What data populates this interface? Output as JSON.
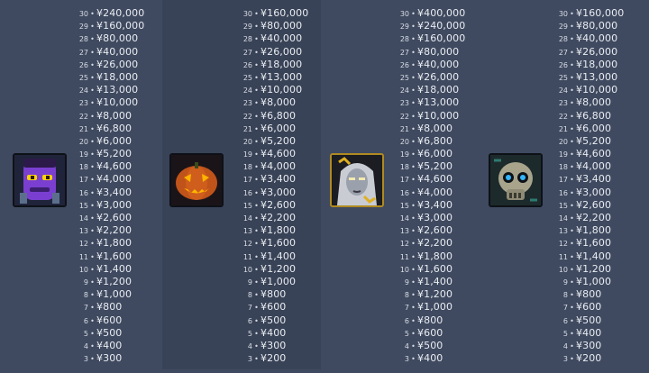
{
  "columns": [
    {
      "character": "purple-zombie",
      "rows": [
        {
          "level": "30",
          "amount": "¥240,000"
        },
        {
          "level": "29",
          "amount": "¥160,000"
        },
        {
          "level": "28",
          "amount": "¥80,000"
        },
        {
          "level": "27",
          "amount": "¥40,000"
        },
        {
          "level": "26",
          "amount": "¥26,000"
        },
        {
          "level": "25",
          "amount": "¥18,000"
        },
        {
          "level": "24",
          "amount": "¥13,000"
        },
        {
          "level": "23",
          "amount": "¥10,000"
        },
        {
          "level": "22",
          "amount": "¥8,000"
        },
        {
          "level": "21",
          "amount": "¥6,800"
        },
        {
          "level": "20",
          "amount": "¥6,000"
        },
        {
          "level": "19",
          "amount": "¥5,200"
        },
        {
          "level": "18",
          "amount": "¥4,600"
        },
        {
          "level": "17",
          "amount": "¥4,000"
        },
        {
          "level": "16",
          "amount": "¥3,400"
        },
        {
          "level": "15",
          "amount": "¥3,000"
        },
        {
          "level": "14",
          "amount": "¥2,600"
        },
        {
          "level": "13",
          "amount": "¥2,200"
        },
        {
          "level": "12",
          "amount": "¥1,800"
        },
        {
          "level": "11",
          "amount": "¥1,600"
        },
        {
          "level": "10",
          "amount": "¥1,400"
        },
        {
          "level": "9",
          "amount": "¥1,200"
        },
        {
          "level": "8",
          "amount": "¥1,000"
        },
        {
          "level": "7",
          "amount": "¥800"
        },
        {
          "level": "6",
          "amount": "¥600"
        },
        {
          "level": "5",
          "amount": "¥500"
        },
        {
          "level": "4",
          "amount": "¥400"
        },
        {
          "level": "3",
          "amount": "¥300"
        }
      ]
    },
    {
      "character": "jack-o-lantern",
      "rows": [
        {
          "level": "30",
          "amount": "¥160,000"
        },
        {
          "level": "29",
          "amount": "¥80,000"
        },
        {
          "level": "28",
          "amount": "¥40,000"
        },
        {
          "level": "27",
          "amount": "¥26,000"
        },
        {
          "level": "26",
          "amount": "¥18,000"
        },
        {
          "level": "25",
          "amount": "¥13,000"
        },
        {
          "level": "24",
          "amount": "¥10,000"
        },
        {
          "level": "23",
          "amount": "¥8,000"
        },
        {
          "level": "22",
          "amount": "¥6,800"
        },
        {
          "level": "21",
          "amount": "¥6,000"
        },
        {
          "level": "20",
          "amount": "¥5,200"
        },
        {
          "level": "19",
          "amount": "¥4,600"
        },
        {
          "level": "18",
          "amount": "¥4,000"
        },
        {
          "level": "17",
          "amount": "¥3,400"
        },
        {
          "level": "16",
          "amount": "¥3,000"
        },
        {
          "level": "15",
          "amount": "¥2,600"
        },
        {
          "level": "14",
          "amount": "¥2,200"
        },
        {
          "level": "13",
          "amount": "¥1,800"
        },
        {
          "level": "12",
          "amount": "¥1,600"
        },
        {
          "level": "11",
          "amount": "¥1,400"
        },
        {
          "level": "10",
          "amount": "¥1,200"
        },
        {
          "level": "9",
          "amount": "¥1,000"
        },
        {
          "level": "8",
          "amount": "¥800"
        },
        {
          "level": "7",
          "amount": "¥600"
        },
        {
          "level": "6",
          "amount": "¥500"
        },
        {
          "level": "5",
          "amount": "¥400"
        },
        {
          "level": "4",
          "amount": "¥300"
        },
        {
          "level": "3",
          "amount": "¥200"
        }
      ]
    },
    {
      "character": "ghost-bride",
      "rows": [
        {
          "level": "30",
          "amount": "¥400,000"
        },
        {
          "level": "29",
          "amount": "¥240,000"
        },
        {
          "level": "28",
          "amount": "¥160,000"
        },
        {
          "level": "27",
          "amount": "¥80,000"
        },
        {
          "level": "26",
          "amount": "¥40,000"
        },
        {
          "level": "25",
          "amount": "¥26,000"
        },
        {
          "level": "24",
          "amount": "¥18,000"
        },
        {
          "level": "23",
          "amount": "¥13,000"
        },
        {
          "level": "22",
          "amount": "¥10,000"
        },
        {
          "level": "21",
          "amount": "¥8,000"
        },
        {
          "level": "20",
          "amount": "¥6,800"
        },
        {
          "level": "19",
          "amount": "¥6,000"
        },
        {
          "level": "18",
          "amount": "¥5,200"
        },
        {
          "level": "17",
          "amount": "¥4,600"
        },
        {
          "level": "16",
          "amount": "¥4,000"
        },
        {
          "level": "15",
          "amount": "¥3,400"
        },
        {
          "level": "14",
          "amount": "¥3,000"
        },
        {
          "level": "13",
          "amount": "¥2,600"
        },
        {
          "level": "12",
          "amount": "¥2,200"
        },
        {
          "level": "11",
          "amount": "¥1,800"
        },
        {
          "level": "10",
          "amount": "¥1,600"
        },
        {
          "level": "9",
          "amount": "¥1,400"
        },
        {
          "level": "8",
          "amount": "¥1,200"
        },
        {
          "level": "7",
          "amount": "¥1,000"
        },
        {
          "level": "6",
          "amount": "¥800"
        },
        {
          "level": "5",
          "amount": "¥600"
        },
        {
          "level": "4",
          "amount": "¥500"
        },
        {
          "level": "3",
          "amount": "¥400"
        }
      ]
    },
    {
      "character": "skull-monster",
      "rows": [
        {
          "level": "30",
          "amount": "¥160,000"
        },
        {
          "level": "29",
          "amount": "¥80,000"
        },
        {
          "level": "28",
          "amount": "¥40,000"
        },
        {
          "level": "27",
          "amount": "¥26,000"
        },
        {
          "level": "26",
          "amount": "¥18,000"
        },
        {
          "level": "25",
          "amount": "¥13,000"
        },
        {
          "level": "24",
          "amount": "¥10,000"
        },
        {
          "level": "23",
          "amount": "¥8,000"
        },
        {
          "level": "22",
          "amount": "¥6,800"
        },
        {
          "level": "21",
          "amount": "¥6,000"
        },
        {
          "level": "20",
          "amount": "¥5,200"
        },
        {
          "level": "19",
          "amount": "¥4,600"
        },
        {
          "level": "18",
          "amount": "¥4,000"
        },
        {
          "level": "17",
          "amount": "¥3,400"
        },
        {
          "level": "16",
          "amount": "¥3,000"
        },
        {
          "level": "15",
          "amount": "¥2,600"
        },
        {
          "level": "14",
          "amount": "¥2,200"
        },
        {
          "level": "13",
          "amount": "¥1,800"
        },
        {
          "level": "12",
          "amount": "¥1,600"
        },
        {
          "level": "11",
          "amount": "¥1,400"
        },
        {
          "level": "10",
          "amount": "¥1,200"
        },
        {
          "level": "9",
          "amount": "¥1,000"
        },
        {
          "level": "8",
          "amount": "¥800"
        },
        {
          "level": "7",
          "amount": "¥600"
        },
        {
          "level": "6",
          "amount": "¥500"
        },
        {
          "level": "5",
          "amount": "¥400"
        },
        {
          "level": "4",
          "amount": "¥300"
        },
        {
          "level": "3",
          "amount": "¥200"
        }
      ]
    }
  ],
  "separator": "•",
  "colors": {
    "background": "#3f4a60",
    "panel_alt": "#394357",
    "text": "#e9ecf1"
  }
}
